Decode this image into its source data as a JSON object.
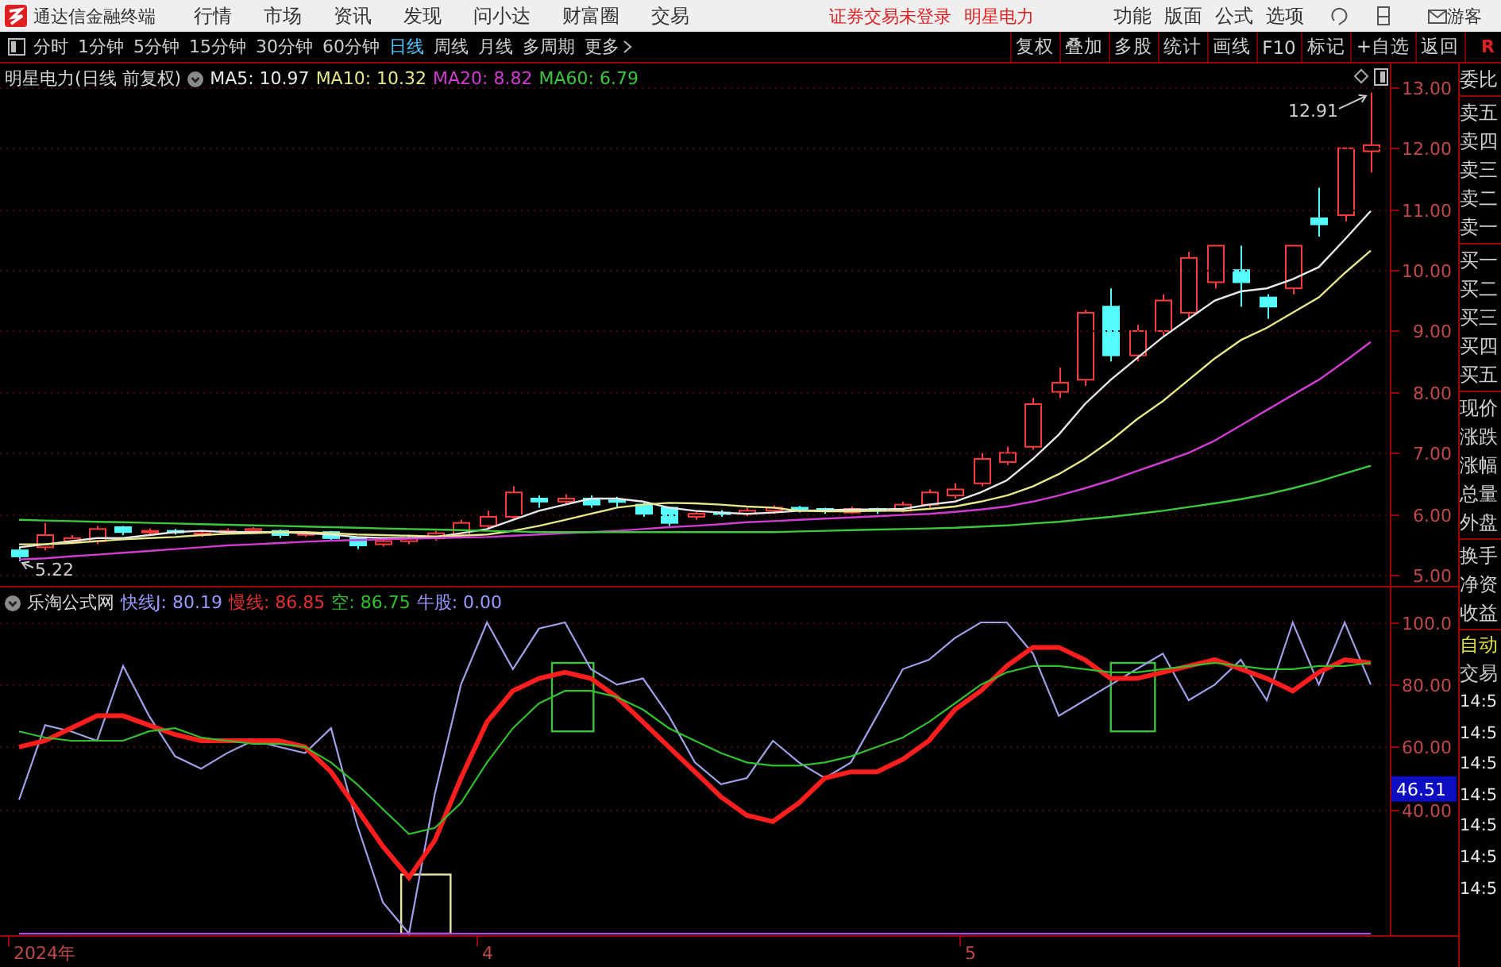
{
  "title_bar": {
    "app_name": "通达信金融终端",
    "menus": [
      "行情",
      "市场",
      "资讯",
      "发现",
      "问小达",
      "财富圈",
      "交易"
    ],
    "notices": [
      "证券交易未登录",
      "明星电力"
    ],
    "tools": [
      "功能",
      "版面",
      "公式",
      "选项"
    ],
    "user": "游客"
  },
  "toolbar": {
    "periods": [
      {
        "label": "分时",
        "selected": false
      },
      {
        "label": "1分钟",
        "selected": false
      },
      {
        "label": "5分钟",
        "selected": false
      },
      {
        "label": "15分钟",
        "selected": false
      },
      {
        "label": "30分钟",
        "selected": false
      },
      {
        "label": "60分钟",
        "selected": false
      },
      {
        "label": "日线",
        "selected": true
      },
      {
        "label": "周线",
        "selected": false
      },
      {
        "label": "月线",
        "selected": false
      },
      {
        "label": "多周期",
        "selected": false
      }
    ],
    "more": "更多",
    "actions": [
      "复权",
      "叠加",
      "多股",
      "统计",
      "画线",
      "F10",
      "标记",
      "+自选",
      "返回"
    ],
    "corner": "R"
  },
  "price_chart": {
    "title": "明星电力(日线 前复权)",
    "legend": [
      "MA5: 10.97",
      "MA10: 10.32",
      "MA20: 8.82",
      "MA60: 6.79"
    ],
    "chart_data": {
      "type": "line",
      "grid": true,
      "series": [
        {
          "color": "#e8e8e8",
          "values": [
            5.45,
            5.5,
            5.55,
            5.6,
            5.6,
            5.65,
            5.7,
            5.72,
            5.7,
            5.7,
            5.7,
            5.68,
            5.66,
            5.62,
            5.6,
            5.6,
            5.62,
            5.68,
            5.75,
            5.9,
            6.05,
            6.15,
            6.25,
            6.25,
            6.2,
            6.1,
            6.05,
            6.02,
            6.0,
            6.02,
            6.05,
            6.06,
            6.07,
            6.07,
            6.08,
            6.15,
            6.2,
            6.35,
            6.55,
            6.9,
            7.3,
            7.8,
            8.2,
            8.55,
            8.9,
            9.2,
            9.5,
            9.65,
            9.7,
            9.85,
            10.05,
            10.5,
            10.97
          ]
        },
        {
          "color": "#e6e68a",
          "values": [
            5.5,
            5.5,
            5.52,
            5.55,
            5.58,
            5.6,
            5.62,
            5.65,
            5.67,
            5.68,
            5.7,
            5.7,
            5.68,
            5.66,
            5.65,
            5.64,
            5.63,
            5.64,
            5.66,
            5.72,
            5.8,
            5.9,
            6.0,
            6.1,
            6.15,
            6.18,
            6.17,
            6.15,
            6.12,
            6.1,
            6.05,
            6.04,
            6.04,
            6.05,
            6.05,
            6.08,
            6.12,
            6.2,
            6.3,
            6.45,
            6.65,
            6.9,
            7.2,
            7.55,
            7.85,
            8.2,
            8.55,
            8.85,
            9.05,
            9.3,
            9.55,
            9.95,
            10.32
          ]
        },
        {
          "color": "#d23cd2",
          "values": [
            5.25,
            5.27,
            5.3,
            5.33,
            5.36,
            5.39,
            5.42,
            5.45,
            5.48,
            5.5,
            5.52,
            5.54,
            5.56,
            5.57,
            5.58,
            5.59,
            5.6,
            5.61,
            5.62,
            5.64,
            5.66,
            5.68,
            5.7,
            5.72,
            5.75,
            5.78,
            5.8,
            5.83,
            5.86,
            5.88,
            5.9,
            5.92,
            5.94,
            5.96,
            5.98,
            6.0,
            6.03,
            6.07,
            6.12,
            6.2,
            6.3,
            6.42,
            6.55,
            6.7,
            6.85,
            7.0,
            7.2,
            7.45,
            7.7,
            7.95,
            8.2,
            8.5,
            8.82
          ]
        },
        {
          "color": "#3cc83c",
          "values": [
            5.9,
            5.89,
            5.88,
            5.87,
            5.86,
            5.85,
            5.84,
            5.83,
            5.82,
            5.81,
            5.8,
            5.79,
            5.78,
            5.77,
            5.76,
            5.75,
            5.74,
            5.73,
            5.72,
            5.71,
            5.7,
            5.7,
            5.7,
            5.7,
            5.7,
            5.7,
            5.7,
            5.7,
            5.7,
            5.7,
            5.71,
            5.72,
            5.73,
            5.74,
            5.75,
            5.76,
            5.77,
            5.79,
            5.81,
            5.84,
            5.87,
            5.91,
            5.95,
            6.0,
            6.05,
            6.11,
            6.17,
            6.24,
            6.32,
            6.42,
            6.53,
            6.66,
            6.79
          ]
        }
      ],
      "ylim": [
        4.79,
        13.39
      ],
      "yticks": [
        {
          "value": 5,
          "label": "5.00"
        },
        {
          "value": 6,
          "label": "6.00"
        },
        {
          "value": 7,
          "label": "7.00"
        },
        {
          "value": 8,
          "label": "8.00"
        },
        {
          "value": 9,
          "label": "9.00"
        },
        {
          "value": 10,
          "label": "10.00"
        },
        {
          "value": 11,
          "label": "11.00"
        },
        {
          "value": 12,
          "label": "12.00"
        },
        {
          "value": 13,
          "label": "13.00"
        }
      ],
      "annotations": [
        {
          "text": "12.91"
        },
        {
          "text": "5.22"
        }
      ]
    }
  },
  "indicator": {
    "name": "乐淘公式网",
    "legend": [
      {
        "text": "快线J: 80.19",
        "color": "#9a9aff"
      },
      {
        "text": "慢线: 86.85",
        "color": "#e03030"
      },
      {
        "text": "空: 86.75",
        "color": "#30c030"
      },
      {
        "text": "牛股: 0.00",
        "color": "#9a9aff"
      }
    ],
    "value_tag": "46.51",
    "date_labels": [
      "2024年",
      "4",
      "5"
    ],
    "chart_data": {
      "type": "line",
      "grid": true,
      "series": [
        {
          "color": "#a0a0e8",
          "values": [
            43,
            67,
            65,
            62,
            86,
            70,
            57,
            53,
            58,
            62,
            60,
            58,
            66,
            35,
            10,
            0,
            45,
            80,
            100,
            85,
            98,
            100,
            85,
            80,
            82,
            70,
            55,
            48,
            50,
            62,
            55,
            50,
            55,
            70,
            85,
            88,
            95,
            100,
            100,
            90,
            70,
            75,
            80,
            85,
            90,
            75,
            80,
            88,
            75,
            100,
            80,
            100,
            80
          ]
        },
        {
          "color": "#ff1e1e",
          "values": [
            60,
            62,
            66,
            70,
            70,
            67,
            64,
            62,
            62,
            62,
            62,
            60,
            52,
            40,
            28,
            18,
            30,
            50,
            68,
            78,
            82,
            84,
            82,
            76,
            68,
            60,
            52,
            44,
            38,
            36,
            42,
            50,
            52,
            52,
            56,
            62,
            72,
            78,
            86,
            92,
            92,
            88,
            82,
            82,
            84,
            86,
            88,
            85,
            82,
            78,
            84,
            88,
            87
          ]
        },
        {
          "color": "#30c030",
          "values": [
            65,
            63,
            62,
            62,
            62,
            65,
            66,
            63,
            62,
            61,
            61,
            60,
            55,
            48,
            40,
            32,
            34,
            42,
            55,
            66,
            74,
            78,
            78,
            76,
            72,
            66,
            62,
            58,
            55,
            54,
            54,
            55,
            57,
            60,
            63,
            68,
            74,
            80,
            84,
            86,
            86,
            85,
            84,
            84,
            85,
            86,
            87,
            86,
            85,
            85,
            86,
            86,
            87
          ]
        },
        {
          "color": "#c040ff",
          "values": [
            0,
            0,
            0,
            0,
            0,
            0,
            0,
            0,
            0,
            0,
            0,
            0,
            0,
            0,
            0,
            0,
            0,
            0,
            0,
            0,
            0,
            0,
            0,
            0,
            0,
            0,
            0,
            0,
            0,
            0,
            0,
            0,
            0,
            0,
            0,
            0,
            0,
            0,
            0,
            0,
            0,
            0,
            0,
            0,
            0,
            0,
            0,
            0,
            0,
            0,
            0,
            0,
            0
          ]
        }
      ],
      "ylim": [
        0,
        100
      ],
      "yticks": [
        {
          "value": 40,
          "label": "40.00"
        },
        {
          "value": 60,
          "label": "60.00"
        },
        {
          "value": 80,
          "label": "80.00"
        },
        {
          "value": 100,
          "label": "100.0"
        }
      ]
    }
  },
  "quote_panel": {
    "groups": [
      [
        "委比"
      ],
      [
        "卖五",
        "卖四",
        "卖三",
        "卖二",
        "卖一"
      ],
      [
        "买一",
        "买二",
        "买三",
        "买四",
        "买五"
      ],
      [
        "现价",
        "涨跌",
        "涨幅",
        "总量",
        "外盘"
      ],
      [
        "换手",
        "净资",
        "收益"
      ]
    ]
  },
  "trade_panel": {
    "mode": "自动",
    "label": "交易",
    "times": [
      "14:5",
      "14:5",
      "14:5",
      "14:5",
      "14:5",
      "14:5",
      "14:5"
    ]
  }
}
